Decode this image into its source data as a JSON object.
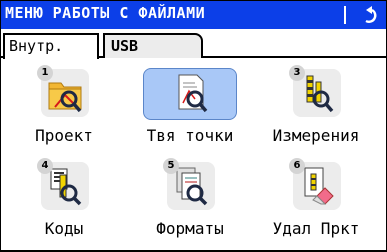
{
  "title": "МЕНЮ РАБОТЫ С ФАЙЛАМИ",
  "tabs": [
    {
      "label": "Внутр.",
      "active": true
    },
    {
      "label": "USB",
      "active": false
    }
  ],
  "items": [
    {
      "number": "1",
      "label": "Проект",
      "icon": "project-folder-icon"
    },
    {
      "number": "",
      "label": "Твя точки",
      "icon": "points-doc-icon",
      "selected": true
    },
    {
      "number": "3",
      "label": "Измерения",
      "icon": "measurements-icon"
    },
    {
      "number": "4",
      "label": "Коды",
      "icon": "codes-icon"
    },
    {
      "number": "5",
      "label": "Форматы",
      "icon": "formats-icon"
    },
    {
      "number": "6",
      "label": "Удал Пркт",
      "icon": "delete-project-icon"
    }
  ],
  "colors": {
    "titlebar": "#0c3fe8",
    "selected_tile": "#a9c8f7",
    "tile": "#ececec"
  }
}
